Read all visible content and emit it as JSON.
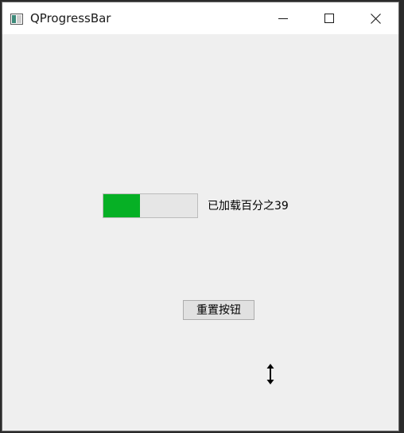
{
  "window": {
    "title": "QProgressBar",
    "icons": {
      "app": "qt-app-icon",
      "minimize": "minimize-icon",
      "maximize": "maximize-icon",
      "close": "close-icon"
    }
  },
  "progress": {
    "value": 39,
    "label": "已加载百分之39",
    "fill_color": "#06b025"
  },
  "reset_button": {
    "label": "重置按钮"
  },
  "cursor": {
    "icon": "vertical-resize-cursor-icon"
  }
}
